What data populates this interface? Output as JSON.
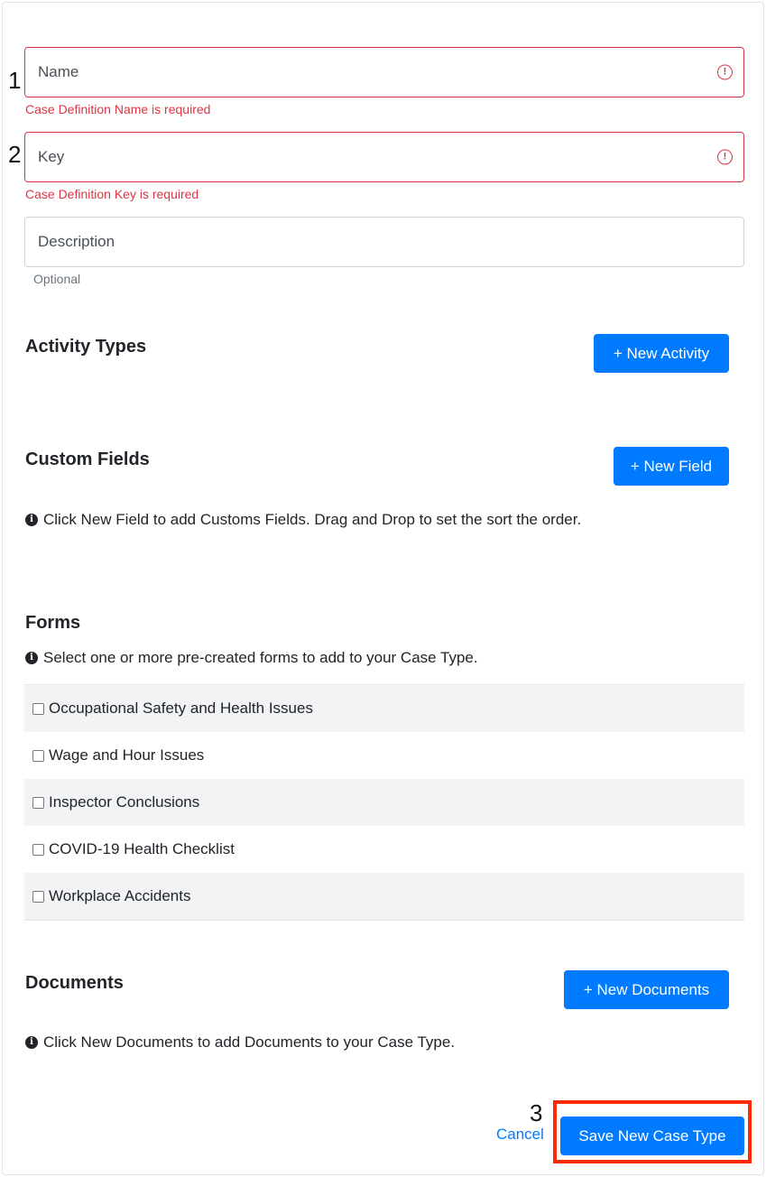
{
  "annotations": {
    "step1": "1",
    "step2": "2",
    "step3": "3"
  },
  "fields": {
    "name": {
      "placeholder": "Name",
      "error": "Case Definition Name is required"
    },
    "key": {
      "placeholder": "Key",
      "error": "Case Definition Key is required"
    },
    "description": {
      "placeholder": "Description",
      "hint": "Optional"
    }
  },
  "activity_types": {
    "title": "Activity Types",
    "button": "+ New Activity"
  },
  "custom_fields": {
    "title": "Custom Fields",
    "button": "+ New Field",
    "info": "Click New Field to add Customs Fields. Drag and Drop to set the sort the order."
  },
  "forms": {
    "title": "Forms",
    "info": "Select one or more pre-created forms to add to your Case Type.",
    "items": [
      {
        "label": "Occupational Safety and Health Issues",
        "checked": false
      },
      {
        "label": "Wage and Hour Issues",
        "checked": false
      },
      {
        "label": "Inspector Conclusions",
        "checked": false
      },
      {
        "label": "COVID-19 Health Checklist",
        "checked": false
      },
      {
        "label": "Workplace Accidents",
        "checked": false
      }
    ]
  },
  "documents": {
    "title": "Documents",
    "button": "+ New Documents",
    "info": "Click New Documents to add Documents to your Case Type."
  },
  "footer": {
    "cancel": "Cancel",
    "save": "Save New Case Type"
  },
  "icons": {
    "error": "exclamation-circle-icon",
    "info": "info-circle-icon"
  },
  "colors": {
    "primary": "#007bff",
    "danger": "#dc3545",
    "highlight": "#ff2a00"
  }
}
